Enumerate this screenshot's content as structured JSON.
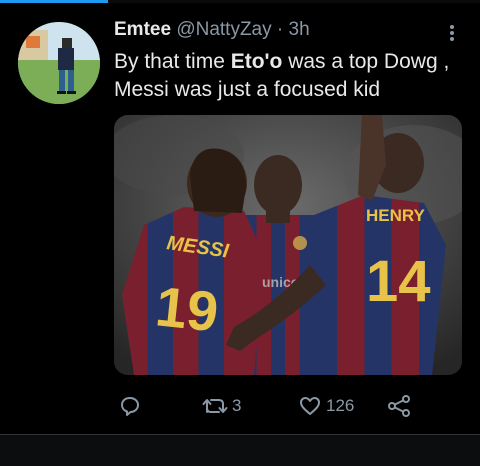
{
  "colors": {
    "background": "#000000",
    "text_primary": "#e7e9ea",
    "text_secondary": "#8b98a5",
    "accent": "#1d9bf0"
  },
  "tweet": {
    "author_name": "Emtee",
    "handle": "@NattyZay",
    "separator": "·",
    "time": "3h",
    "text_part1": "By that time ",
    "text_bold": "Eto'o",
    "text_part2": " was a top Dowg ,",
    "text_line2": "Messi was just a focused kid",
    "media": {
      "jersey_left_name": "MESSI",
      "jersey_left_number": "19",
      "jersey_right_name": "HENRY",
      "jersey_right_number": "14"
    },
    "actions": {
      "reply_icon": "reply-icon",
      "retweet_icon": "retweet-icon",
      "retweet_count": "3",
      "like_icon": "heart-icon",
      "like_count": "126",
      "share_icon": "share-icon"
    }
  }
}
